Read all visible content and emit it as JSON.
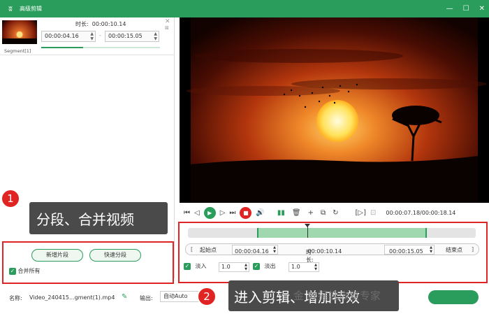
{
  "window": {
    "title": "高级剪辑",
    "logo_icon": "rabbit-icon",
    "min_icon": "—",
    "max_icon": "☐",
    "close_icon": "✕"
  },
  "segment": {
    "label": "Segment[1]",
    "duration_label": "时长:",
    "duration": "00:00:10.14",
    "start": "00:00:04.16",
    "end": "00:00:15.05",
    "separator": "-"
  },
  "left_panel": {
    "new_segment": "新增片段",
    "quick_split": "快速分段",
    "merge_all": "合并所有"
  },
  "callouts": {
    "one": {
      "num": "1",
      "text": "分段、合并视频"
    },
    "two": {
      "num": "2",
      "text": "进入剪辑、增加特效"
    }
  },
  "player": {
    "time": "00:00:07.18/00:00:18.14"
  },
  "trim": {
    "start_label": "起始点",
    "start_value": "00:00:04.16",
    "duration_label": "时长:",
    "duration_value": "00:00:10.14",
    "end_value": "00:00:15.05",
    "end_label": "结束点",
    "left_bracket": "[",
    "right_bracket": "]"
  },
  "fade": {
    "fade_in_label": "淡入",
    "fade_in_value": "1.0",
    "fade_out_label": "淡出",
    "fade_out_value": "1.0"
  },
  "bottom": {
    "name_label": "名称:",
    "filename": "Video_240415...gment(1).mp4",
    "output_label": "输出:",
    "output_value": "自动Auto"
  },
  "watermark": "金 数据蛙恢复专家",
  "colors": {
    "accent": "#2a9d5c",
    "highlight": "#e02424",
    "callout_bg": "#4a4a4a"
  }
}
